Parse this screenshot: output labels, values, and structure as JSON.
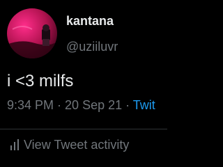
{
  "user": {
    "display_name": "kantana",
    "handle": "@uziiluvr"
  },
  "tweet": {
    "text": "i <3 milfs",
    "time": "9:34 PM",
    "separator_1": " · ",
    "date": "20 Sep 21",
    "separator_2": " · ",
    "source_truncated": "Twit"
  },
  "actions": {
    "activity_label": "View Tweet activity",
    "activity_icon": "bar-chart-icon"
  },
  "colors": {
    "background": "#000000",
    "primary_text": "#e7e9ea",
    "secondary_text": "#71767b",
    "link": "#1d9bf0",
    "divider": "#2f3336",
    "avatar_accent": "#d81b60"
  }
}
